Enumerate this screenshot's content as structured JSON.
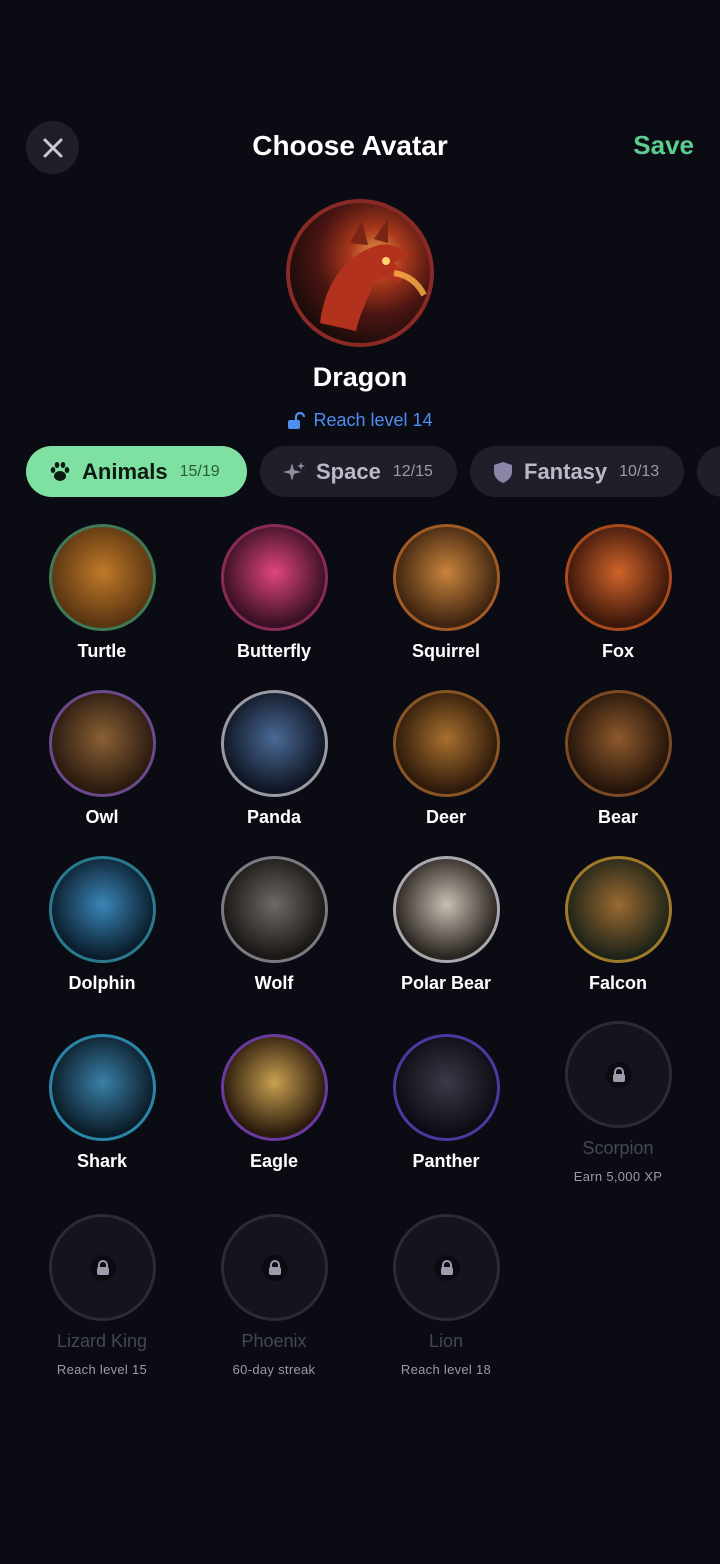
{
  "header": {
    "title": "Choose Avatar",
    "save_label": "Save"
  },
  "selected": {
    "name": "Dragon",
    "requirement": "Reach level 14"
  },
  "tabs": [
    {
      "label": "Animals",
      "count": "15/19",
      "icon": "paw-icon",
      "active": true
    },
    {
      "label": "Space",
      "count": "12/15",
      "icon": "sparkle-icon",
      "active": false
    },
    {
      "label": "Fantasy",
      "count": "10/13",
      "icon": "shield-icon",
      "active": false
    }
  ],
  "avatars": [
    {
      "name": "Turtle",
      "ring": "#3d7a55",
      "colors": [
        "#c07a28",
        "#5a3512"
      ]
    },
    {
      "name": "Butterfly",
      "ring": "#8a2b55",
      "colors": [
        "#e0457c",
        "#3a1025"
      ]
    },
    {
      "name": "Squirrel",
      "ring": "#a15a24",
      "colors": [
        "#c9843c",
        "#3e2410"
      ]
    },
    {
      "name": "Fox",
      "ring": "#a84a1c",
      "colors": [
        "#d0642a",
        "#3c170b"
      ]
    },
    {
      "name": "Owl",
      "ring": "#6a4a8c",
      "colors": [
        "#8a6034",
        "#2a1a10"
      ]
    },
    {
      "name": "Panda",
      "ring": "#9a9aa2",
      "colors": [
        "#4b6a96",
        "#0f1523"
      ]
    },
    {
      "name": "Deer",
      "ring": "#8a5524",
      "colors": [
        "#a8702e",
        "#2e1a0a"
      ]
    },
    {
      "name": "Bear",
      "ring": "#7a4a22",
      "colors": [
        "#8e5a2c",
        "#24140b"
      ]
    },
    {
      "name": "Dolphin",
      "ring": "#2a7a8e",
      "colors": [
        "#3a86b8",
        "#0b1d2c"
      ]
    },
    {
      "name": "Wolf",
      "ring": "#7a7a82",
      "colors": [
        "#6d6a66",
        "#1a1715"
      ]
    },
    {
      "name": "Polar Bear",
      "ring": "#a8a8ae",
      "colors": [
        "#c8bfb4",
        "#2b2520"
      ]
    },
    {
      "name": "Falcon",
      "ring": "#a07a2a",
      "colors": [
        "#9a6a32",
        "#1f2418"
      ]
    },
    {
      "name": "Shark",
      "ring": "#2a86a8",
      "colors": [
        "#3a80a8",
        "#0b1c28"
      ]
    },
    {
      "name": "Eagle",
      "ring": "#6a3aa0",
      "colors": [
        "#c8a050",
        "#2a1a0c"
      ]
    },
    {
      "name": "Panther",
      "ring": "#4a3aa0",
      "colors": [
        "#3a3a48",
        "#0c0c14"
      ]
    },
    {
      "name": "Scorpion",
      "locked": true,
      "requirement": "Earn 5,000 XP"
    },
    {
      "name": "Lizard King",
      "locked": true,
      "requirement": "Reach level 15"
    },
    {
      "name": "Phoenix",
      "locked": true,
      "requirement": "60-day streak"
    },
    {
      "name": "Lion",
      "locked": true,
      "requirement": "Reach level 18"
    }
  ]
}
